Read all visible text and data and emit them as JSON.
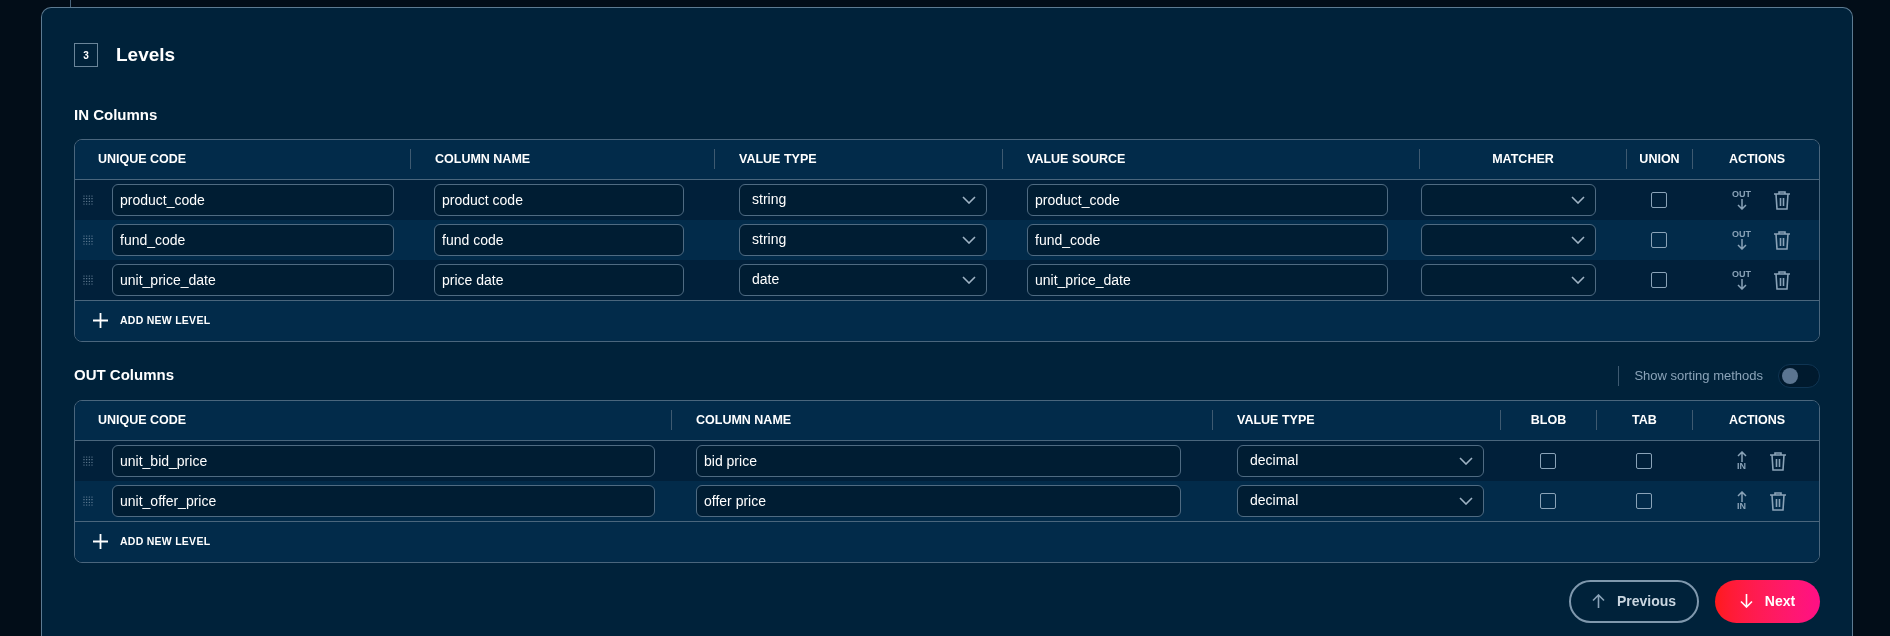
{
  "step": {
    "number": "3",
    "title": "Levels"
  },
  "in_columns": {
    "title": "IN Columns",
    "columns": [
      "UNIQUE CODE",
      "COLUMN NAME",
      "VALUE TYPE",
      "VALUE SOURCE",
      "MATCHER",
      "UNION",
      "ACTIONS"
    ],
    "rows": [
      {
        "unique_code": "product_code",
        "column_name": "product code",
        "value_type": "string",
        "value_source": "product_code",
        "union": {
          "checked": false
        },
        "move_label": "OUT"
      },
      {
        "unique_code": "fund_code",
        "column_name": "fund code",
        "value_type": "string",
        "value_source": "fund_code",
        "union": {
          "checked": false
        },
        "move_label": "OUT"
      },
      {
        "unique_code": "unit_price_date",
        "column_name": "price date",
        "value_type": "date",
        "value_source": "unit_price_date",
        "union": {
          "checked": false
        },
        "move_label": "OUT"
      }
    ],
    "add_label": "ADD NEW LEVEL"
  },
  "out_columns": {
    "title": "OUT Columns",
    "toggle": {
      "label": "Show sorting methods",
      "on": false
    },
    "columns": [
      "UNIQUE CODE",
      "COLUMN NAME",
      "VALUE TYPE",
      "BLOB",
      "TAB",
      "ACTIONS"
    ],
    "rows": [
      {
        "unique_code": "unit_bid_price",
        "column_name": "bid price",
        "value_type": "decimal",
        "blob": {
          "checked": false
        },
        "tab": {
          "checked": false
        },
        "move_label": "IN"
      },
      {
        "unique_code": "unit_offer_price",
        "column_name": "offer price",
        "value_type": "decimal",
        "blob": {
          "checked": false
        },
        "tab": {
          "checked": false
        },
        "move_label": "IN"
      }
    ],
    "add_label": "ADD NEW LEVEL"
  },
  "nav": {
    "previous": "Previous",
    "next": "Next"
  }
}
